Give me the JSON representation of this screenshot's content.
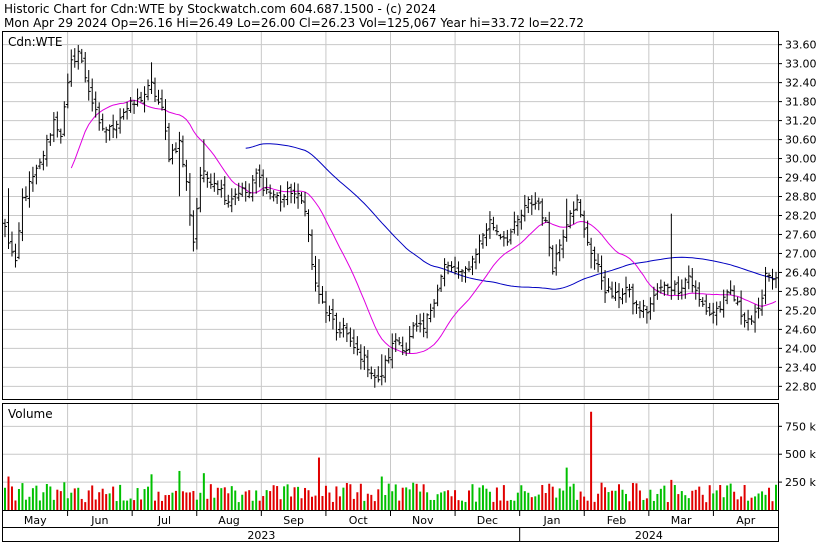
{
  "header": {
    "line1": "Historic Chart for Cdn:WTE by Stockwatch.com 604.687.1500 - (c) 2024",
    "line2": "Mon Apr 29 2024  Op=26.16  Hi=26.49  Lo=26.00  Cl=26.23  Vol=125,067  Year hi=33.72  lo=22.72"
  },
  "price_panel": {
    "label": "Cdn:WTE",
    "y_ticks": [
      "33.60",
      "33.00",
      "32.40",
      "31.80",
      "31.20",
      "30.60",
      "30.00",
      "29.40",
      "28.80",
      "28.20",
      "27.60",
      "27.00",
      "26.40",
      "25.80",
      "25.20",
      "24.60",
      "24.00",
      "23.40",
      "22.80"
    ]
  },
  "volume_panel": {
    "label": "Volume",
    "y_ticks": [
      "750 k",
      "500 k",
      "250 k"
    ]
  },
  "x_axis": {
    "months": [
      "May",
      "Jun",
      "Jul",
      "Aug",
      "Sep",
      "Oct",
      "Nov",
      "Dec",
      "Jan",
      "Feb",
      "Mar",
      "Apr"
    ],
    "years": [
      "2023",
      "2024"
    ]
  },
  "colors": {
    "ma_short": "#e000e0",
    "ma_long": "#0000c0",
    "vol_up": "#00c000",
    "vol_down": "#e00000",
    "bar": "#000000",
    "grid": "#c8c8c8"
  },
  "chart_data": {
    "type": "ohlc_bar",
    "symbol": "Cdn:WTE",
    "price_range": [
      22.4,
      34.0
    ],
    "volume_range": [
      0,
      950000
    ],
    "months": [
      "May",
      "Jun",
      "Jul",
      "Aug",
      "Sep",
      "Oct",
      "Nov",
      "Dec",
      "Jan",
      "Feb",
      "Mar",
      "Apr"
    ],
    "close_anchors": [
      [
        0,
        27.8
      ],
      [
        3,
        26.6
      ],
      [
        5,
        28.7
      ],
      [
        10,
        29.8
      ],
      [
        14,
        31.2
      ],
      [
        16,
        30.8
      ],
      [
        19,
        33.0
      ],
      [
        21,
        33.4
      ],
      [
        24,
        32.2
      ],
      [
        27,
        31.0
      ],
      [
        30,
        30.9
      ],
      [
        34,
        31.5
      ],
      [
        38,
        31.8
      ],
      [
        42,
        32.3
      ],
      [
        45,
        31.5
      ],
      [
        47,
        30.1
      ],
      [
        50,
        30.5
      ],
      [
        52,
        29.2
      ],
      [
        54,
        27.4
      ],
      [
        56,
        29.5
      ],
      [
        60,
        29.3
      ],
      [
        64,
        28.7
      ],
      [
        67,
        29.0
      ],
      [
        70,
        28.9
      ],
      [
        72,
        29.5
      ],
      [
        75,
        29.0
      ],
      [
        79,
        28.7
      ],
      [
        82,
        29.0
      ],
      [
        86,
        28.5
      ],
      [
        88,
        26.6
      ],
      [
        90,
        25.6
      ],
      [
        93,
        25.0
      ],
      [
        95,
        24.5
      ],
      [
        97,
        24.7
      ],
      [
        99,
        24.1
      ],
      [
        102,
        23.8
      ],
      [
        105,
        23.3
      ],
      [
        107,
        22.9
      ],
      [
        110,
        23.8
      ],
      [
        112,
        24.3
      ],
      [
        115,
        24.0
      ],
      [
        117,
        24.6
      ],
      [
        120,
        24.6
      ],
      [
        123,
        25.6
      ],
      [
        126,
        26.6
      ],
      [
        128,
        26.5
      ],
      [
        131,
        26.3
      ],
      [
        134,
        26.8
      ],
      [
        137,
        27.6
      ],
      [
        139,
        28.0
      ],
      [
        142,
        27.6
      ],
      [
        144,
        27.5
      ],
      [
        147,
        28.0
      ],
      [
        150,
        28.6
      ],
      [
        153,
        28.6
      ],
      [
        155,
        27.9
      ],
      [
        157,
        26.6
      ],
      [
        159,
        27.3
      ],
      [
        162,
        28.4
      ],
      [
        164,
        28.6
      ],
      [
        166,
        27.7
      ],
      [
        168,
        27.1
      ],
      [
        170,
        26.5
      ],
      [
        172,
        25.9
      ],
      [
        175,
        25.6
      ],
      [
        178,
        25.9
      ],
      [
        181,
        25.3
      ],
      [
        184,
        25.2
      ],
      [
        187,
        25.8
      ],
      [
        190,
        26.0
      ],
      [
        193,
        25.9
      ],
      [
        196,
        26.3
      ],
      [
        199,
        25.5
      ],
      [
        202,
        25.1
      ],
      [
        205,
        25.3
      ],
      [
        208,
        25.8
      ],
      [
        211,
        25.1
      ],
      [
        214,
        24.9
      ],
      [
        216,
        25.1
      ],
      [
        218,
        26.4
      ],
      [
        221,
        26.23
      ]
    ],
    "spikes": [
      {
        "i": 1,
        "d": 0.8,
        "v": 300000
      },
      {
        "i": 42,
        "d": 0.5,
        "v": 320000
      },
      {
        "i": 50,
        "d": -1.2,
        "v": 350000
      },
      {
        "i": 57,
        "d": 0.7,
        "v": 330000
      },
      {
        "i": 90,
        "d": 0.6,
        "v": 470000
      },
      {
        "i": 108,
        "d": 0.4,
        "v": 300000
      },
      {
        "i": 161,
        "d": 0.5,
        "v": 380000
      },
      {
        "i": 168,
        "d": -0.4,
        "v": 880000
      },
      {
        "i": 191,
        "d": 2.0,
        "v": 270000
      }
    ],
    "volume_range_typical": [
      70000,
      250000
    ]
  }
}
